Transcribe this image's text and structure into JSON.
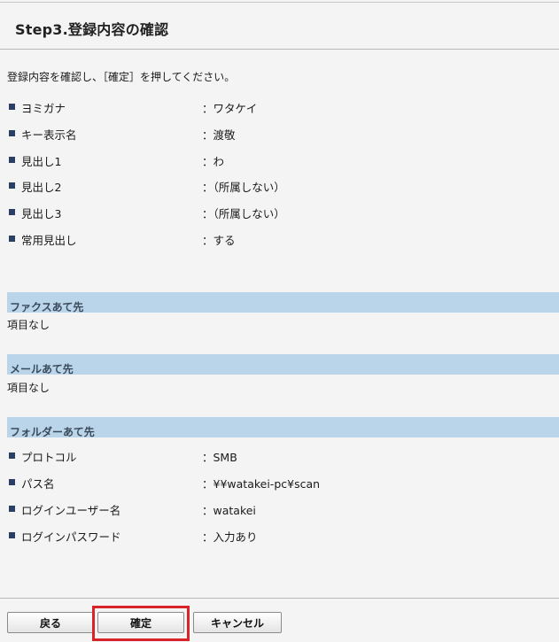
{
  "page": {
    "title": "Step3.登録内容の確認",
    "instruction": "登録内容を確認し、［確定］を押してください。"
  },
  "registration": {
    "rows": [
      {
        "label": "ヨミガナ",
        "value": "：ワタケイ"
      },
      {
        "label": "キー表示名",
        "value": "：渡敬"
      },
      {
        "label": "見出し1",
        "value": "：わ"
      },
      {
        "label": "見出し2",
        "value": "：（所属しない）"
      },
      {
        "label": "見出し3",
        "value": "：（所属しない）"
      },
      {
        "label": "常用見出し",
        "value": "：する"
      }
    ]
  },
  "fax_section": {
    "header": "ファクスあて先",
    "empty_text": "項目なし"
  },
  "mail_section": {
    "header": "メールあて先",
    "empty_text": "項目なし"
  },
  "folder_section": {
    "header": "フォルダーあて先",
    "rows": [
      {
        "label": "プロトコル",
        "value": "：SMB"
      },
      {
        "label": "パス名",
        "value": "：¥¥watakei-pc¥scan"
      },
      {
        "label": "ログインユーザー名",
        "value": "：watakei"
      },
      {
        "label": "ログインパスワード",
        "value": "：入力あり"
      }
    ]
  },
  "buttons": {
    "back": "戻る",
    "confirm": "確定",
    "cancel": "キャンセル"
  },
  "colors": {
    "section_header_bg": "#bad5ea",
    "bullet": "#2a3f66",
    "highlight": "#d8232a"
  },
  "icons": {
    "bullet": "square-bullet-icon"
  }
}
